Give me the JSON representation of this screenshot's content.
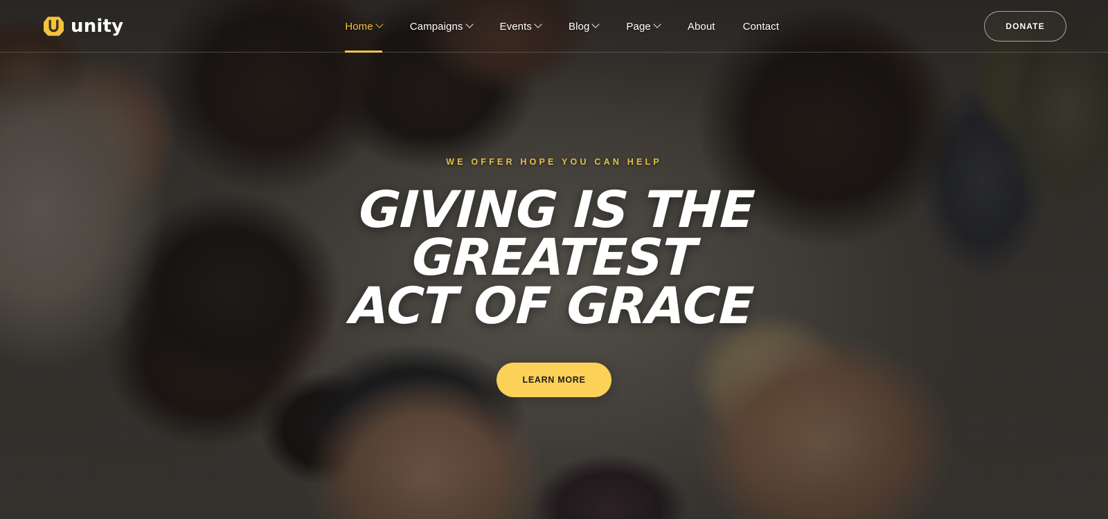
{
  "brand": {
    "name": "unity",
    "logo_icon": "unity-hexagon-logo-icon",
    "accent_color": "#f4c33c"
  },
  "nav": {
    "items": [
      {
        "label": "Home",
        "has_dropdown": true,
        "active": true
      },
      {
        "label": "Campaigns",
        "has_dropdown": true,
        "active": false
      },
      {
        "label": "Events",
        "has_dropdown": true,
        "active": false
      },
      {
        "label": "Blog",
        "has_dropdown": true,
        "active": false
      },
      {
        "label": "Page",
        "has_dropdown": true,
        "active": false
      },
      {
        "label": "About",
        "has_dropdown": false,
        "active": false
      },
      {
        "label": "Contact",
        "has_dropdown": false,
        "active": false
      }
    ]
  },
  "header": {
    "donate_label": "DONATE"
  },
  "hero": {
    "eyebrow": "WE OFFER HOPE YOU CAN HELP",
    "title_line1": "GIVING IS THE",
    "title_line2": "GREATEST",
    "title_line3": "ACT OF GRACE",
    "cta_label": "LEARN MORE",
    "cta_color": "#fbd158",
    "eyebrow_color": "#e7bf45",
    "background_description": "Circle of smiling people photographed from below, darkened overlay"
  }
}
